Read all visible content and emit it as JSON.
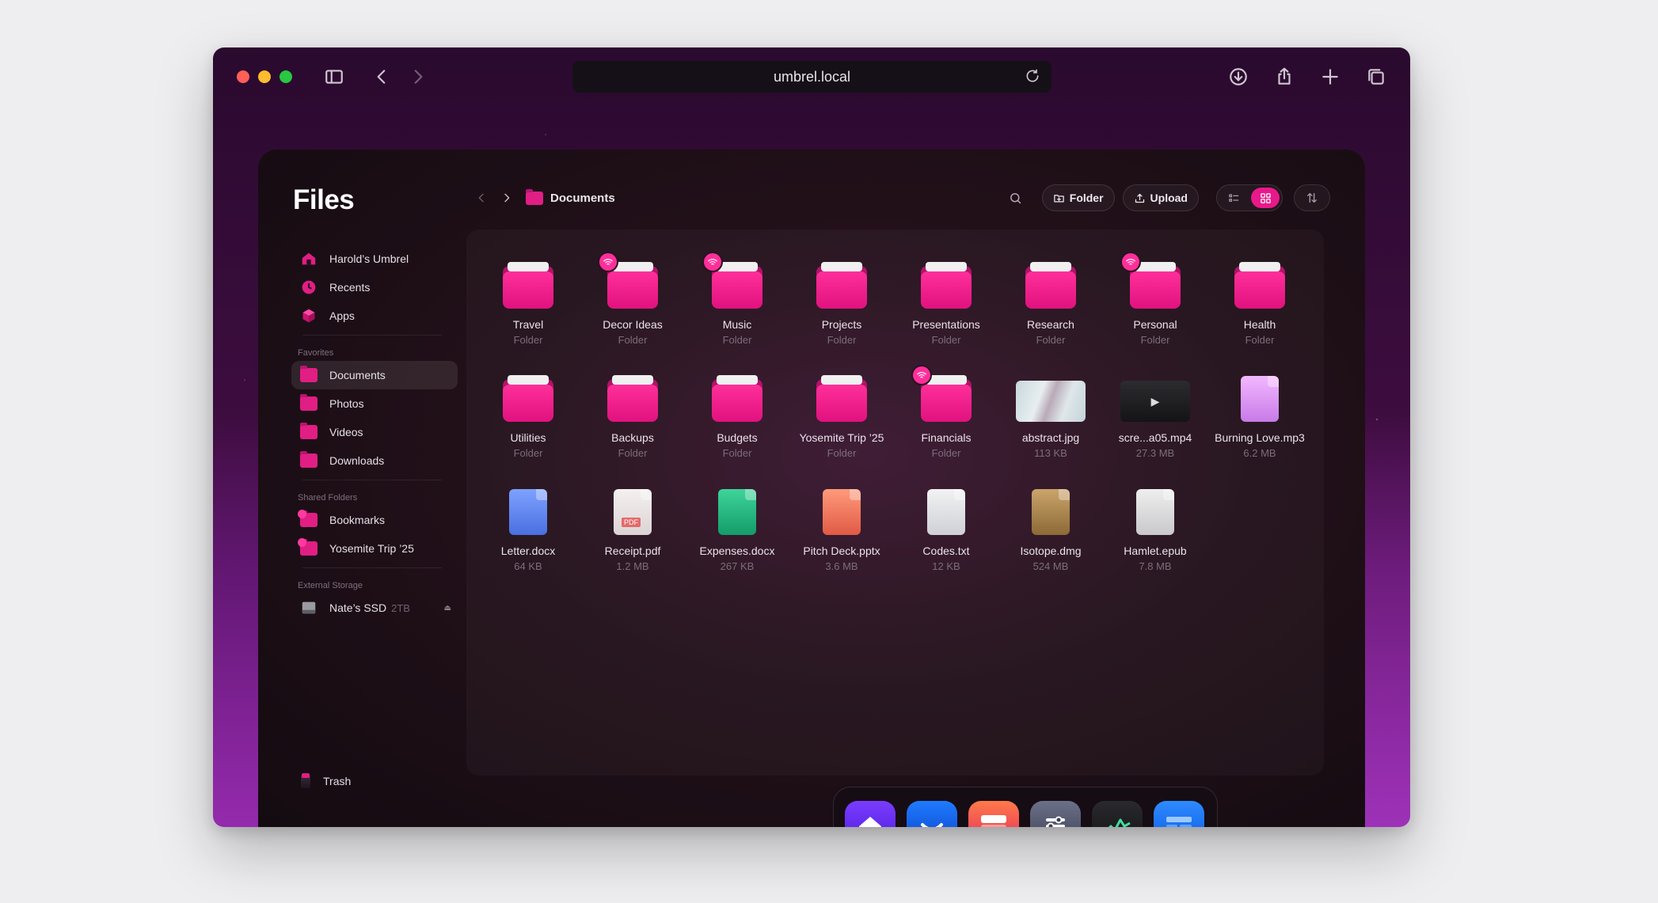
{
  "browser": {
    "url": "umbrel.local",
    "icons": [
      "sidebar-icon",
      "back-icon",
      "forward-icon",
      "reload-icon",
      "download-icon",
      "share-icon",
      "new-tab-icon",
      "tabs-icon"
    ]
  },
  "app": {
    "title": "Files",
    "accent": "#e8198a"
  },
  "sidebar": {
    "main": [
      {
        "label": "Harold’s Umbrel",
        "icon": "home-icon"
      },
      {
        "label": "Recents",
        "icon": "clock-icon"
      },
      {
        "label": "Apps",
        "icon": "cube-icon"
      }
    ],
    "favorites_heading": "Favorites",
    "favorites": [
      {
        "label": "Documents",
        "active": true
      },
      {
        "label": "Photos"
      },
      {
        "label": "Videos"
      },
      {
        "label": "Downloads"
      }
    ],
    "shared_heading": "Shared Folders",
    "shared": [
      {
        "label": "Bookmarks"
      },
      {
        "label": "Yosemite Trip ’25"
      }
    ],
    "external_heading": "External Storage",
    "external": [
      {
        "label": "Nate’s SSD",
        "size": "2TB"
      }
    ],
    "trash_label": "Trash"
  },
  "breadcrumb": {
    "current": "Documents"
  },
  "actions": {
    "folder_label": "Folder",
    "upload_label": "Upload"
  },
  "files": [
    {
      "name": "Travel",
      "sub": "Folder",
      "kind": "folder",
      "shared": false
    },
    {
      "name": "Decor Ideas",
      "sub": "Folder",
      "kind": "folder",
      "shared": true
    },
    {
      "name": "Music",
      "sub": "Folder",
      "kind": "folder",
      "shared": true
    },
    {
      "name": "Projects",
      "sub": "Folder",
      "kind": "folder",
      "shared": false
    },
    {
      "name": "Presentations",
      "sub": "Folder",
      "kind": "folder",
      "shared": false
    },
    {
      "name": "Research",
      "sub": "Folder",
      "kind": "folder",
      "shared": false
    },
    {
      "name": "Personal",
      "sub": "Folder",
      "kind": "folder",
      "shared": true
    },
    {
      "name": "Health",
      "sub": "Folder",
      "kind": "folder",
      "shared": false
    },
    {
      "name": "Utilities",
      "sub": "Folder",
      "kind": "folder",
      "shared": false
    },
    {
      "name": "Backups",
      "sub": "Folder",
      "kind": "folder",
      "shared": false
    },
    {
      "name": "Budgets",
      "sub": "Folder",
      "kind": "folder",
      "shared": false
    },
    {
      "name": "Yosemite Trip ’25",
      "sub": "Folder",
      "kind": "folder",
      "shared": false
    },
    {
      "name": "Financials",
      "sub": "Folder",
      "kind": "folder",
      "shared": true
    },
    {
      "name": "abstract.jpg",
      "sub": "113 KB",
      "kind": "image"
    },
    {
      "name": "scre...a05.mp4",
      "sub": "27.3 MB",
      "kind": "video"
    },
    {
      "name": "Burning Love.mp3",
      "sub": "6.2 MB",
      "kind": "audio"
    },
    {
      "name": "Letter.docx",
      "sub": "64 KB",
      "kind": "docx"
    },
    {
      "name": "Receipt.pdf",
      "sub": "1.2 MB",
      "kind": "pdf"
    },
    {
      "name": "Expenses.docx",
      "sub": "267 KB",
      "kind": "sheet"
    },
    {
      "name": "Pitch Deck.pptx",
      "sub": "3.6 MB",
      "kind": "pptx"
    },
    {
      "name": "Codes.txt",
      "sub": "12 KB",
      "kind": "txt"
    },
    {
      "name": "Isotope.dmg",
      "sub": "524 MB",
      "kind": "dmg"
    },
    {
      "name": "Hamlet.epub",
      "sub": "7.8 MB",
      "kind": "epub"
    }
  ],
  "dock": [
    {
      "name": "home-app-icon"
    },
    {
      "name": "app-store-icon"
    },
    {
      "name": "files-app-icon",
      "active": true
    },
    {
      "name": "settings-app-icon"
    },
    {
      "name": "live-usage-app-icon"
    },
    {
      "name": "widgets-app-icon"
    }
  ]
}
